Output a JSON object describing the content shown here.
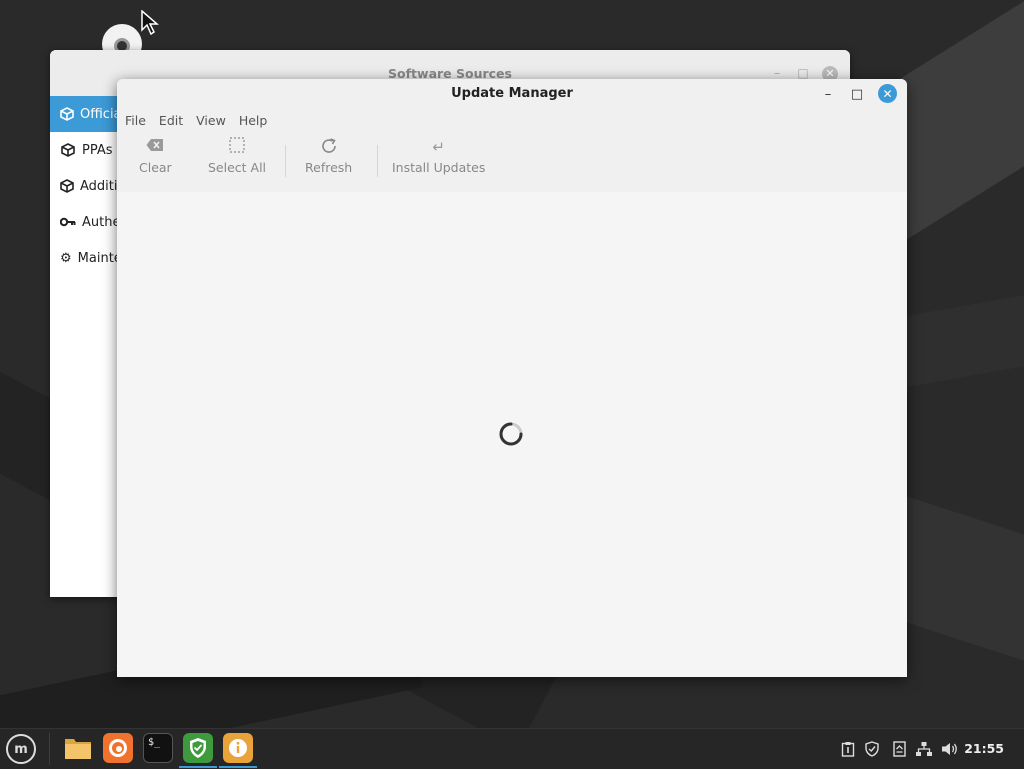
{
  "background_window": {
    "title": "Software Sources",
    "sidebar_items": [
      {
        "label": "Official",
        "icon": "package-icon",
        "active": true
      },
      {
        "label": "PPAs",
        "icon": "package-icon",
        "active": false
      },
      {
        "label": "Additional",
        "icon": "package-icon",
        "active": false
      },
      {
        "label": "Authentication",
        "icon": "key-icon",
        "active": false
      },
      {
        "label": "Maintenance",
        "icon": "gear-icon",
        "active": false
      }
    ]
  },
  "update_manager": {
    "title": "Update Manager",
    "window_controls": {
      "minimize": "–",
      "maximize": "□",
      "close": "✕"
    },
    "menu": [
      "File",
      "Edit",
      "View",
      "Help"
    ],
    "toolbar": {
      "clear": "Clear",
      "select_all": "Select All",
      "refresh": "Refresh",
      "install_updates": "Install Updates"
    },
    "status": "loading-spinner"
  },
  "taskbar": {
    "menu_icon": "mint-logo-icon",
    "apps": [
      "files-icon",
      "firefox-icon",
      "terminal-icon",
      "update-manager-icon",
      "info-icon"
    ],
    "tray": [
      "clipboard-icon",
      "shield-icon",
      "notes-icon",
      "network-icon",
      "volume-icon"
    ],
    "clock": "21:55"
  },
  "colors": {
    "accent": "#3c9ad6",
    "taskbar": "#262626",
    "update_manager_icon": "#3d9a3d",
    "firefox": "#f0722c",
    "info": "#e8a33a"
  }
}
